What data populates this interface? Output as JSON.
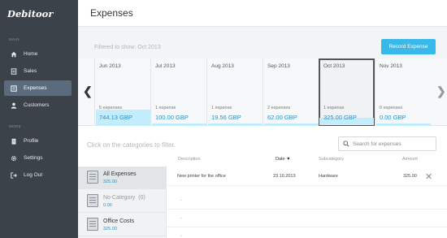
{
  "app": {
    "logo": "Debitoor"
  },
  "sidebar": {
    "section_main": "MAIN",
    "section_more": "MORE",
    "items": [
      {
        "label": "Home",
        "icon": "home-icon",
        "active": false
      },
      {
        "label": "Sales",
        "icon": "document-icon",
        "active": false
      },
      {
        "label": "Expenses",
        "icon": "list-icon",
        "active": true
      },
      {
        "label": "Customers",
        "icon": "user-icon",
        "active": false
      },
      {
        "label": "Profile",
        "icon": "building-icon",
        "active": false
      },
      {
        "label": "Settings",
        "icon": "gear-icon",
        "active": false
      },
      {
        "label": "Log Out",
        "icon": "logout-icon",
        "active": false
      }
    ]
  },
  "header": {
    "title": "Expenses"
  },
  "filter": {
    "text": "Filtered to show: Oct 2013",
    "record_button": "Record Expense"
  },
  "months": [
    {
      "label": "Jun 2013",
      "count": "5 expenses",
      "amount": "744.13 GBP",
      "value": 744.13,
      "selected": false
    },
    {
      "label": "Jul 2013",
      "count": "1 expense",
      "amount": "100.00 GBP",
      "value": 100.0,
      "selected": false
    },
    {
      "label": "Aug 2013",
      "count": "1 expense",
      "amount": "19.56 GBP",
      "value": 19.56,
      "selected": false
    },
    {
      "label": "Sep 2013",
      "count": "2 expenses",
      "amount": "62.00 GBP",
      "value": 62.0,
      "selected": false
    },
    {
      "label": "Oct 2013",
      "count": "1 expense",
      "amount": "325.00 GBP",
      "value": 325.0,
      "selected": true
    },
    {
      "label": "Nov 2013",
      "count": "0 expenses",
      "amount": "0.00 GBP",
      "value": 0.0,
      "selected": false
    }
  ],
  "categories_hint": "Click on the categories to filter.",
  "search": {
    "placeholder": "Search for expenses"
  },
  "columns": {
    "description": "Description",
    "date": "Date",
    "subcategory": "Subcategory",
    "amount": "Amount"
  },
  "categories": [
    {
      "name": "All Expenses",
      "total": "325.00",
      "active": true
    },
    {
      "name": "No Category",
      "count": "(0)",
      "total": "0.00",
      "active": false
    },
    {
      "name": "Office Costs",
      "total": "325.00",
      "active": false
    }
  ],
  "rows": [
    {
      "description": "New printer for the office",
      "date": "23.10.2013",
      "subcategory": "Hardware",
      "amount": "325.00"
    }
  ],
  "placeholder_rows": [
    "-",
    "-",
    "-"
  ]
}
